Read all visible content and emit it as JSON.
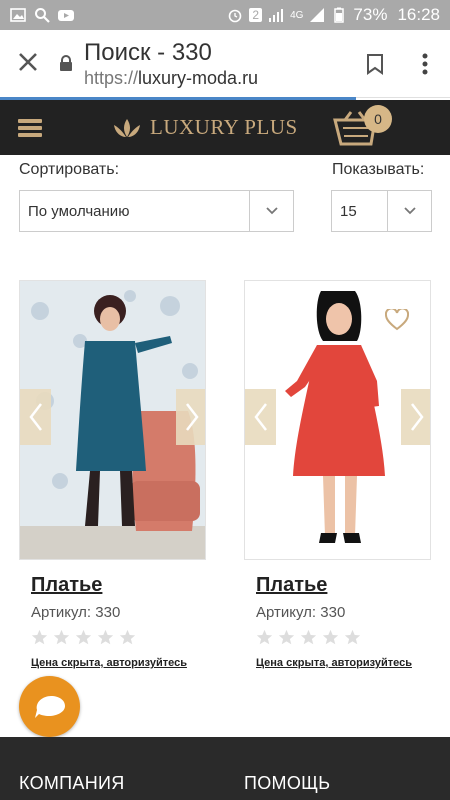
{
  "status_bar": {
    "notification_icons": [
      "image-icon",
      "search-icon",
      "youtube-icon"
    ],
    "sim_badge": "2",
    "network": "4G",
    "battery": "73%",
    "time": "16:28"
  },
  "browser": {
    "page_title": "Поиск - 330",
    "url_scheme": "https://",
    "url_host": "luxury-moda.ru",
    "load_progress": 0.79
  },
  "header": {
    "logo_text": "LUXURY PLUS",
    "cart_count": "0"
  },
  "controls": {
    "sort_label": "Сортировать:",
    "sort_value": "По умолчанию",
    "show_label": "Показывать:",
    "show_value": "15"
  },
  "products": [
    {
      "name": "Платье",
      "article": "Артикул: 330",
      "rating": 0,
      "price_note": "Цена скрыта, авторизуйтесь",
      "dress_color": "#1f5f7a"
    },
    {
      "name": "Платье",
      "article": "Артикул: 330",
      "rating": 0,
      "price_note": "Цена скрыта, авторизуйтесь",
      "dress_color": "#e2463c"
    }
  ],
  "footer": {
    "col1": "КОМПАНИЯ",
    "col2": "ПОМОЩЬ"
  },
  "colors": {
    "accent_gold": "#c8a97d",
    "header_bg": "#222222",
    "chat_orange": "#e9921f"
  }
}
